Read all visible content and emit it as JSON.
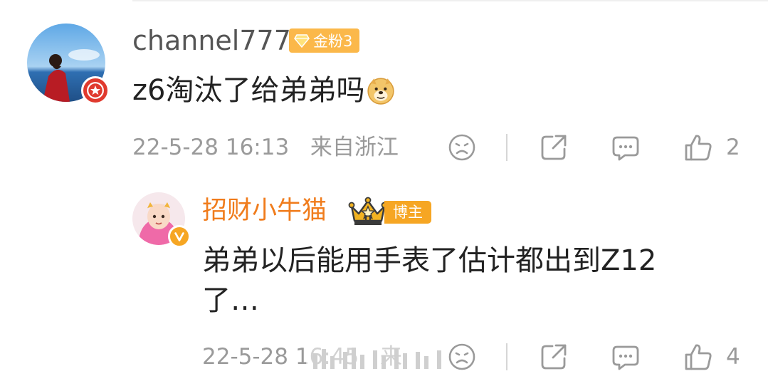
{
  "comment": {
    "username": "channel777",
    "fan_badge": {
      "label": "金粉3",
      "color": "#fbb84a"
    },
    "avatar_badge_icon": "star-badge-icon",
    "text": "z6淘汰了给弟弟吗",
    "emoji": "doge-emoji",
    "timestamp": "22-5-28 16:13",
    "location": "来自浙江",
    "like_count": "2"
  },
  "reply": {
    "username": "招财小牛猫",
    "username_color": "#f07c1c",
    "crown_badge_icon": "crown-ii-icon",
    "author_tag": "博主",
    "avatar_badge_icon": "verified-v-icon",
    "text_line1": "弟弟以后能用手表了估计都出到Z12",
    "text_line2": "了…",
    "timestamp": "22-5-28 16:45",
    "location_partial": "来",
    "like_count": "4"
  },
  "actions": [
    "dislike-face-icon",
    "share-icon",
    "comment-icon",
    "like-thumb-icon"
  ]
}
